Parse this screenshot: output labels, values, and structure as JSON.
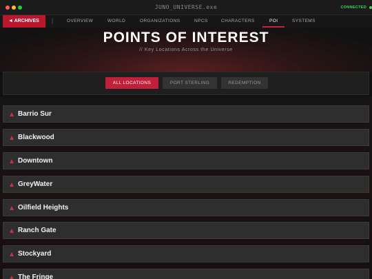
{
  "window": {
    "title": "JUNO_UNIVERSE.exe",
    "status": "CONNECTED",
    "status_color": "#3ddc56",
    "traffic_lights": [
      "#ff5f57",
      "#febc2e",
      "#28c840"
    ]
  },
  "nav": {
    "archives_label": "◄ ARCHIVES",
    "separator": "|",
    "items": [
      {
        "label": "OVERVIEW"
      },
      {
        "label": "WORLD"
      },
      {
        "label": "ORGANIZATIONS"
      },
      {
        "label": "NPCS"
      },
      {
        "label": "CHARACTERS"
      },
      {
        "label": "POI",
        "active": true
      },
      {
        "label": "SYSTEMS"
      }
    ]
  },
  "header": {
    "title": "POINTS OF INTEREST",
    "subtitle": "// Key Locations Across the Universe"
  },
  "filters": [
    {
      "label": "ALL LOCATIONS",
      "active": true
    },
    {
      "label": "PORT STERLING"
    },
    {
      "label": "REDEMPTION"
    }
  ],
  "locations": [
    {
      "name": "Barrio Sur",
      "icon": "triangle-icon"
    },
    {
      "name": "Blackwood",
      "icon": "triangle-icon"
    },
    {
      "name": "Downtown",
      "icon": "triangle-icon"
    },
    {
      "name": "GreyWater",
      "icon": "triangle-icon"
    },
    {
      "name": "Oilfield Heights",
      "icon": "triangle-icon"
    },
    {
      "name": "Ranch Gate",
      "icon": "triangle-icon"
    },
    {
      "name": "Stockyard",
      "icon": "triangle-icon"
    },
    {
      "name": "The Fringe",
      "icon": "triangle-icon"
    }
  ],
  "colors": {
    "accent": "#c1203b"
  }
}
